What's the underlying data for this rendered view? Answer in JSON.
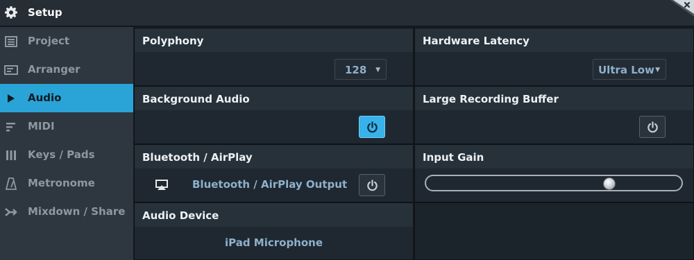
{
  "window": {
    "title": "Setup",
    "close_glyph": "✖"
  },
  "sidebar": {
    "items": [
      {
        "label": "Project",
        "icon": "list-icon",
        "active": false
      },
      {
        "label": "Arranger",
        "icon": "arranger-icon",
        "active": false
      },
      {
        "label": "Audio",
        "icon": "play-icon",
        "active": true
      },
      {
        "label": "MIDI",
        "icon": "midi-icon",
        "active": false
      },
      {
        "label": "Keys / Pads",
        "icon": "keys-icon",
        "active": false
      },
      {
        "label": "Metronome",
        "icon": "metronome-icon",
        "active": false
      },
      {
        "label": "Mixdown / Share",
        "icon": "share-icon",
        "active": false
      }
    ]
  },
  "panels": {
    "polyphony": {
      "title": "Polyphony",
      "value": "128"
    },
    "hardware_latency": {
      "title": "Hardware Latency",
      "value": "Ultra Low"
    },
    "background_audio": {
      "title": "Background Audio",
      "enabled": true
    },
    "large_recording_buffer": {
      "title": "Large Recording Buffer",
      "enabled": false
    },
    "bluetooth": {
      "title": "Bluetooth / AirPlay",
      "output_label": "Bluetooth / AirPlay Output",
      "enabled": false
    },
    "input_gain": {
      "title": "Input Gain",
      "level": 0.73
    },
    "audio_device": {
      "title": "Audio Device",
      "value": "iPad Microphone"
    }
  },
  "colors": {
    "accent": "#2aa3d6",
    "toggle_on": "#38b2ea",
    "value_text": "#8fb0cc"
  }
}
